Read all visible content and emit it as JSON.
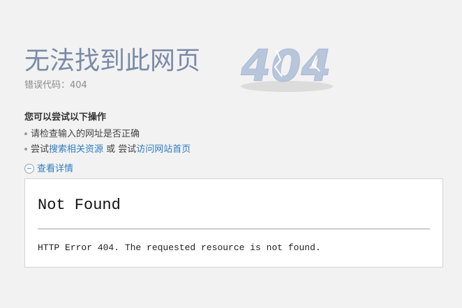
{
  "page": {
    "title": "无法找到此网页",
    "error_code": "错误代码：404",
    "graphic_text": "404"
  },
  "suggestions": {
    "heading": "您可以尝试以下操作",
    "item1": "请检查输入的网址是否正确",
    "item2_prefix": "尝试",
    "item2_link1": "搜索相关资源",
    "item2_middle": " 或 尝试",
    "item2_link2": "访问网站首页"
  },
  "details": {
    "toggle_label": "查看详情",
    "heading": "Not Found",
    "message": "HTTP Error 404. The requested resource is not found."
  },
  "colors": {
    "title": "#7a8ba8",
    "link": "#2f7dc1",
    "graphic_digits": "#b8c6dc",
    "background": "#f2f2f2"
  }
}
